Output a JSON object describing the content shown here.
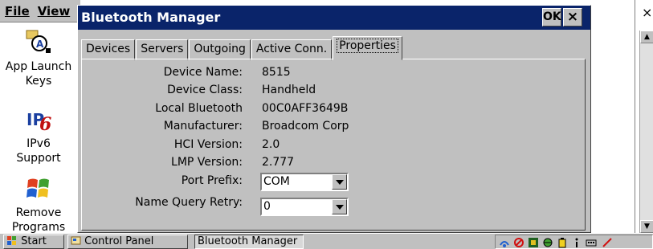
{
  "background_window": {
    "menu": [
      "File",
      "View"
    ],
    "close_glyph": "×",
    "icons": [
      {
        "icon": "app-launch-keys-icon",
        "line1": "App Launch",
        "line2": "Keys"
      },
      {
        "icon": "ipv6-icon",
        "line1": "IPv6",
        "line2": "Support"
      },
      {
        "icon": "remove-programs-icon",
        "line1": "Remove",
        "line2": "Programs"
      }
    ]
  },
  "dialog": {
    "title": "Bluetooth Manager",
    "ok_label": "OK",
    "close_glyph": "×",
    "tabs": [
      "Devices",
      "Servers",
      "Outgoing",
      "Active Conn.",
      "Properties"
    ],
    "active_tab": "Properties",
    "properties": [
      {
        "label": "Device Name:",
        "value": "8515"
      },
      {
        "label": "Device Class:",
        "value": "Handheld"
      },
      {
        "label": "Local Bluetooth",
        "value": "00C0AFF3649B"
      },
      {
        "label": "Manufacturer:",
        "value": "Broadcom Corp"
      },
      {
        "label": "HCI Version:",
        "value": "2.0"
      },
      {
        "label": "LMP Version:",
        "value": "2.777"
      }
    ],
    "port_prefix": {
      "label": "Port Prefix:",
      "value": "COM"
    },
    "name_query_retry": {
      "label": "Name Query Retry:",
      "value": "0"
    }
  },
  "taskbar": {
    "start": "Start",
    "items": [
      "Control Panel",
      "Bluetooth Manager"
    ],
    "active_item": "Bluetooth Manager"
  },
  "colors": {
    "title_bar": "#0a246a",
    "window_face": "#c0c0c0"
  }
}
